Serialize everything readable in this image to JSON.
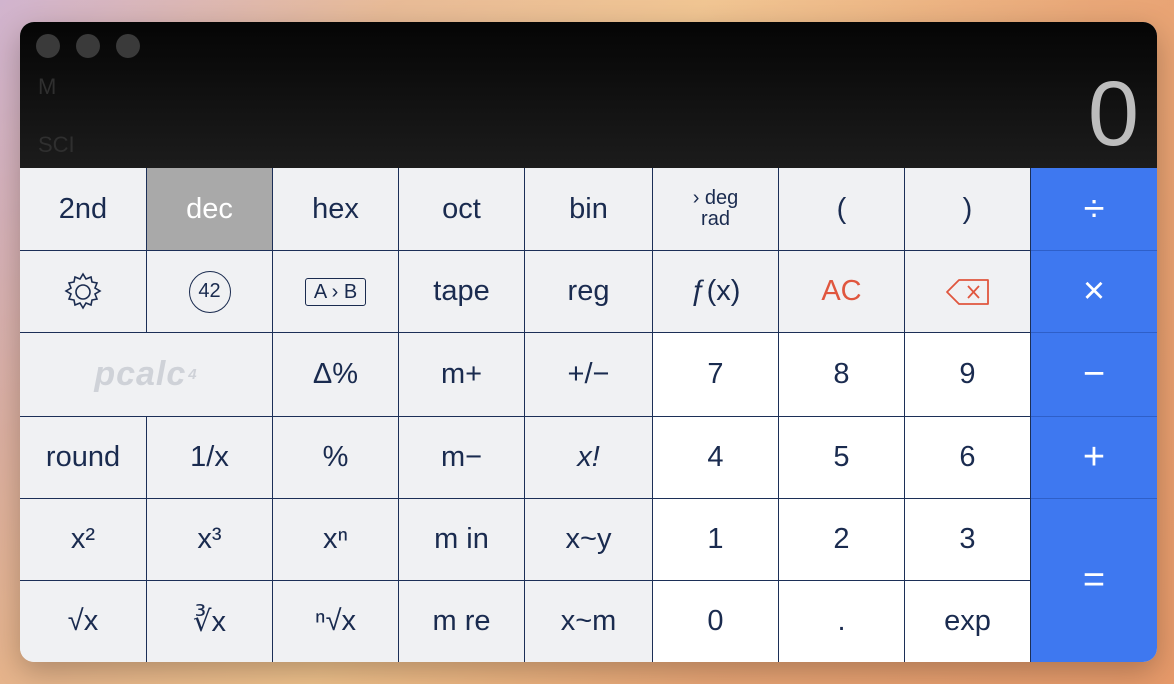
{
  "display": {
    "memory_indicator": "M",
    "mode_indicator": "SCI",
    "value": "0"
  },
  "keys": {
    "second": "2nd",
    "dec": "dec",
    "hex": "hex",
    "oct": "oct",
    "bin": "bin",
    "deg_arrow": "› deg",
    "rad": "rad",
    "lparen": "(",
    "rparen": ")",
    "divide": "÷",
    "const_42": "42",
    "convert": "A › B",
    "tape": "tape",
    "reg": "reg",
    "function": "ƒ(x)",
    "ac": "AC",
    "multiply": "×",
    "logo_text": "pcalc",
    "logo_sup": "4",
    "delta_percent": "Δ%",
    "m_plus": "m+",
    "plus_minus": "+/−",
    "seven": "7",
    "eight": "8",
    "nine": "9",
    "minus": "−",
    "round": "round",
    "reciprocal": "1/x",
    "percent": "%",
    "m_minus": "m−",
    "factorial": "x!",
    "four": "4",
    "five": "5",
    "six": "6",
    "plus": "+",
    "square": "x²",
    "cube": "x³",
    "power_n": "xⁿ",
    "m_in": "m in",
    "swap_xy": "x~y",
    "one": "1",
    "two": "2",
    "three": "3",
    "equals": "=",
    "sqrt": "√x",
    "cbrt": "∛x",
    "nroot": "ⁿ√x",
    "m_re": "m re",
    "swap_xm": "x~m",
    "zero": "0",
    "point": ".",
    "exp": "exp"
  },
  "colors": {
    "operator_blue": "#3e78f0",
    "ac_red": "#e0563e",
    "selected_gray": "#a9a9a9"
  }
}
